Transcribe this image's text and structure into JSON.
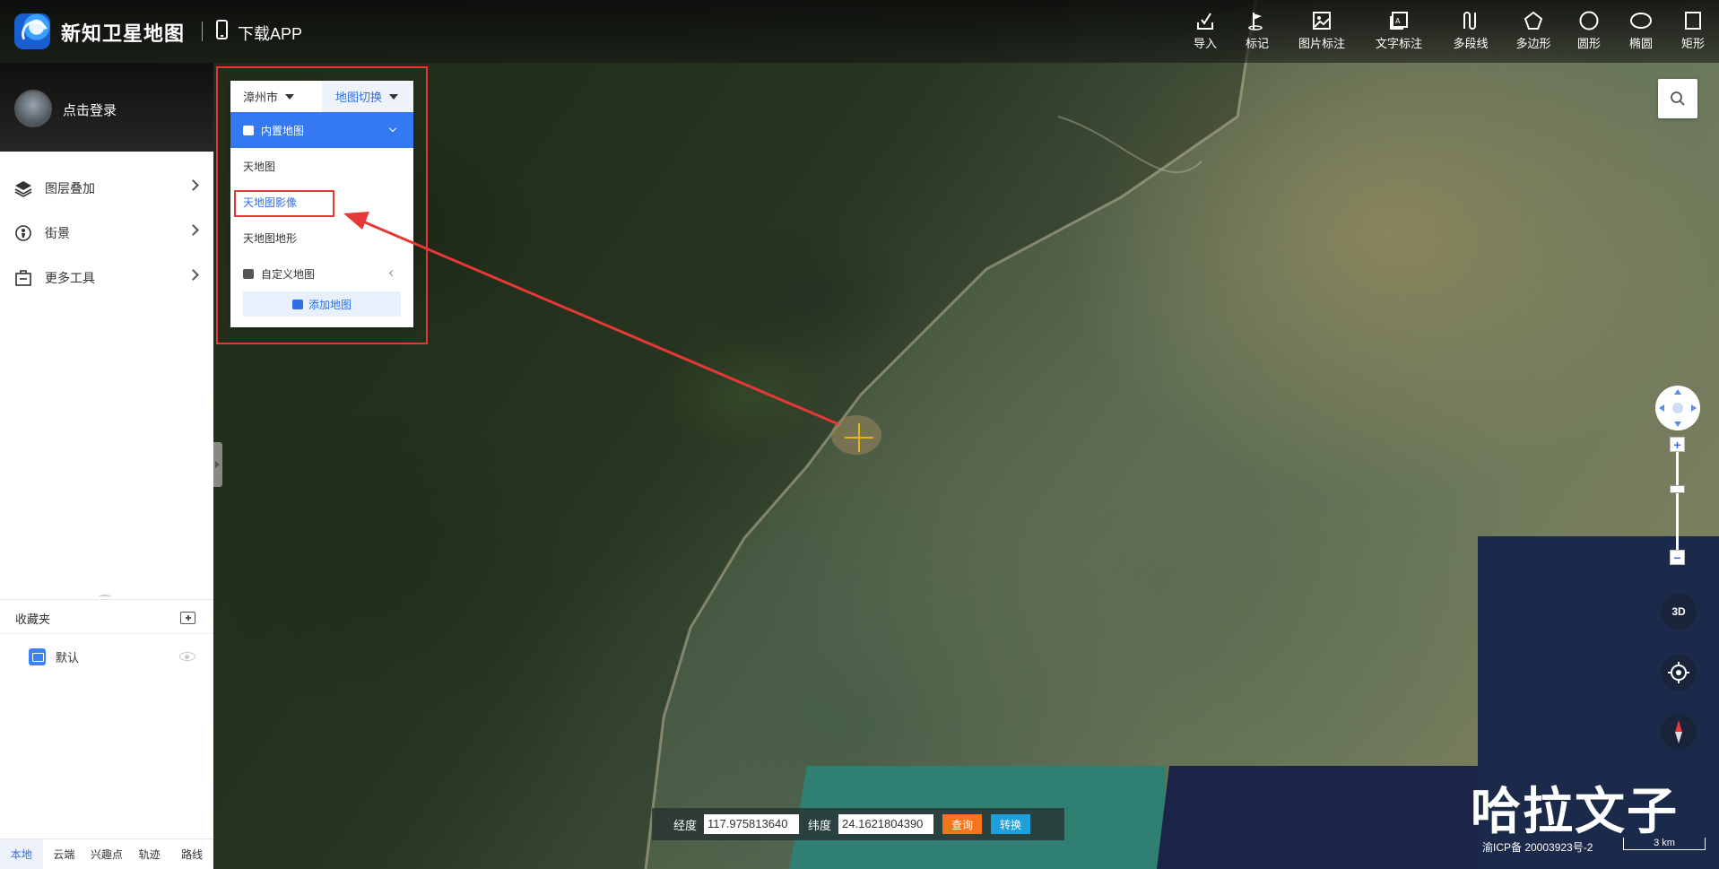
{
  "header": {
    "brand": "新知卫星地图",
    "download_label": "下载APP",
    "tools": [
      {
        "label": "导入",
        "icon": "import-icon"
      },
      {
        "label": "标记",
        "icon": "flag-icon"
      },
      {
        "label": "图片标注",
        "icon": "image-annotation-icon"
      },
      {
        "label": "文字标注",
        "icon": "text-annotation-icon"
      },
      {
        "label": "多段线",
        "icon": "polyline-icon"
      },
      {
        "label": "多边形",
        "icon": "polygon-icon"
      },
      {
        "label": "圆形",
        "icon": "circle-icon"
      },
      {
        "label": "椭圆",
        "icon": "ellipse-icon"
      },
      {
        "label": "矩形",
        "icon": "rectangle-icon"
      }
    ]
  },
  "sidebar": {
    "login": "点击登录",
    "menu": [
      {
        "label": "图层叠加",
        "icon": "layers-icon"
      },
      {
        "label": "街景",
        "icon": "street-view-icon"
      },
      {
        "label": "更多工具",
        "icon": "toolbox-icon"
      }
    ],
    "favorites": {
      "title": "收藏夹",
      "items": [
        {
          "label": "默认"
        }
      ]
    },
    "bottom_tabs": [
      "本地",
      "云端",
      "兴趣点",
      "轨迹",
      "路线"
    ],
    "active_tab": "本地"
  },
  "map_switcher": {
    "city": "漳州市",
    "switch_label": "地图切换",
    "group_label": "内置地图",
    "options": [
      "天地图",
      "天地图影像",
      "天地图地形"
    ],
    "selected": "天地图影像",
    "custom_label": "自定义地图",
    "add_label": "添加地图"
  },
  "coordinates": {
    "lon_label": "经度",
    "lon_value": "117.975813640",
    "lat_label": "纬度",
    "lat_value": "24.1621804390",
    "query_label": "查询",
    "convert_label": "转换"
  },
  "controls": {
    "three_d_label": "3D"
  },
  "footer": {
    "watermark": "哈拉文子",
    "icp": "渝ICP备 20003923号-2",
    "scale": "3 km"
  },
  "colors": {
    "accent": "#3479f2",
    "annotation": "#e53935",
    "query": "#f5741d",
    "convert": "#1fa0dc"
  }
}
